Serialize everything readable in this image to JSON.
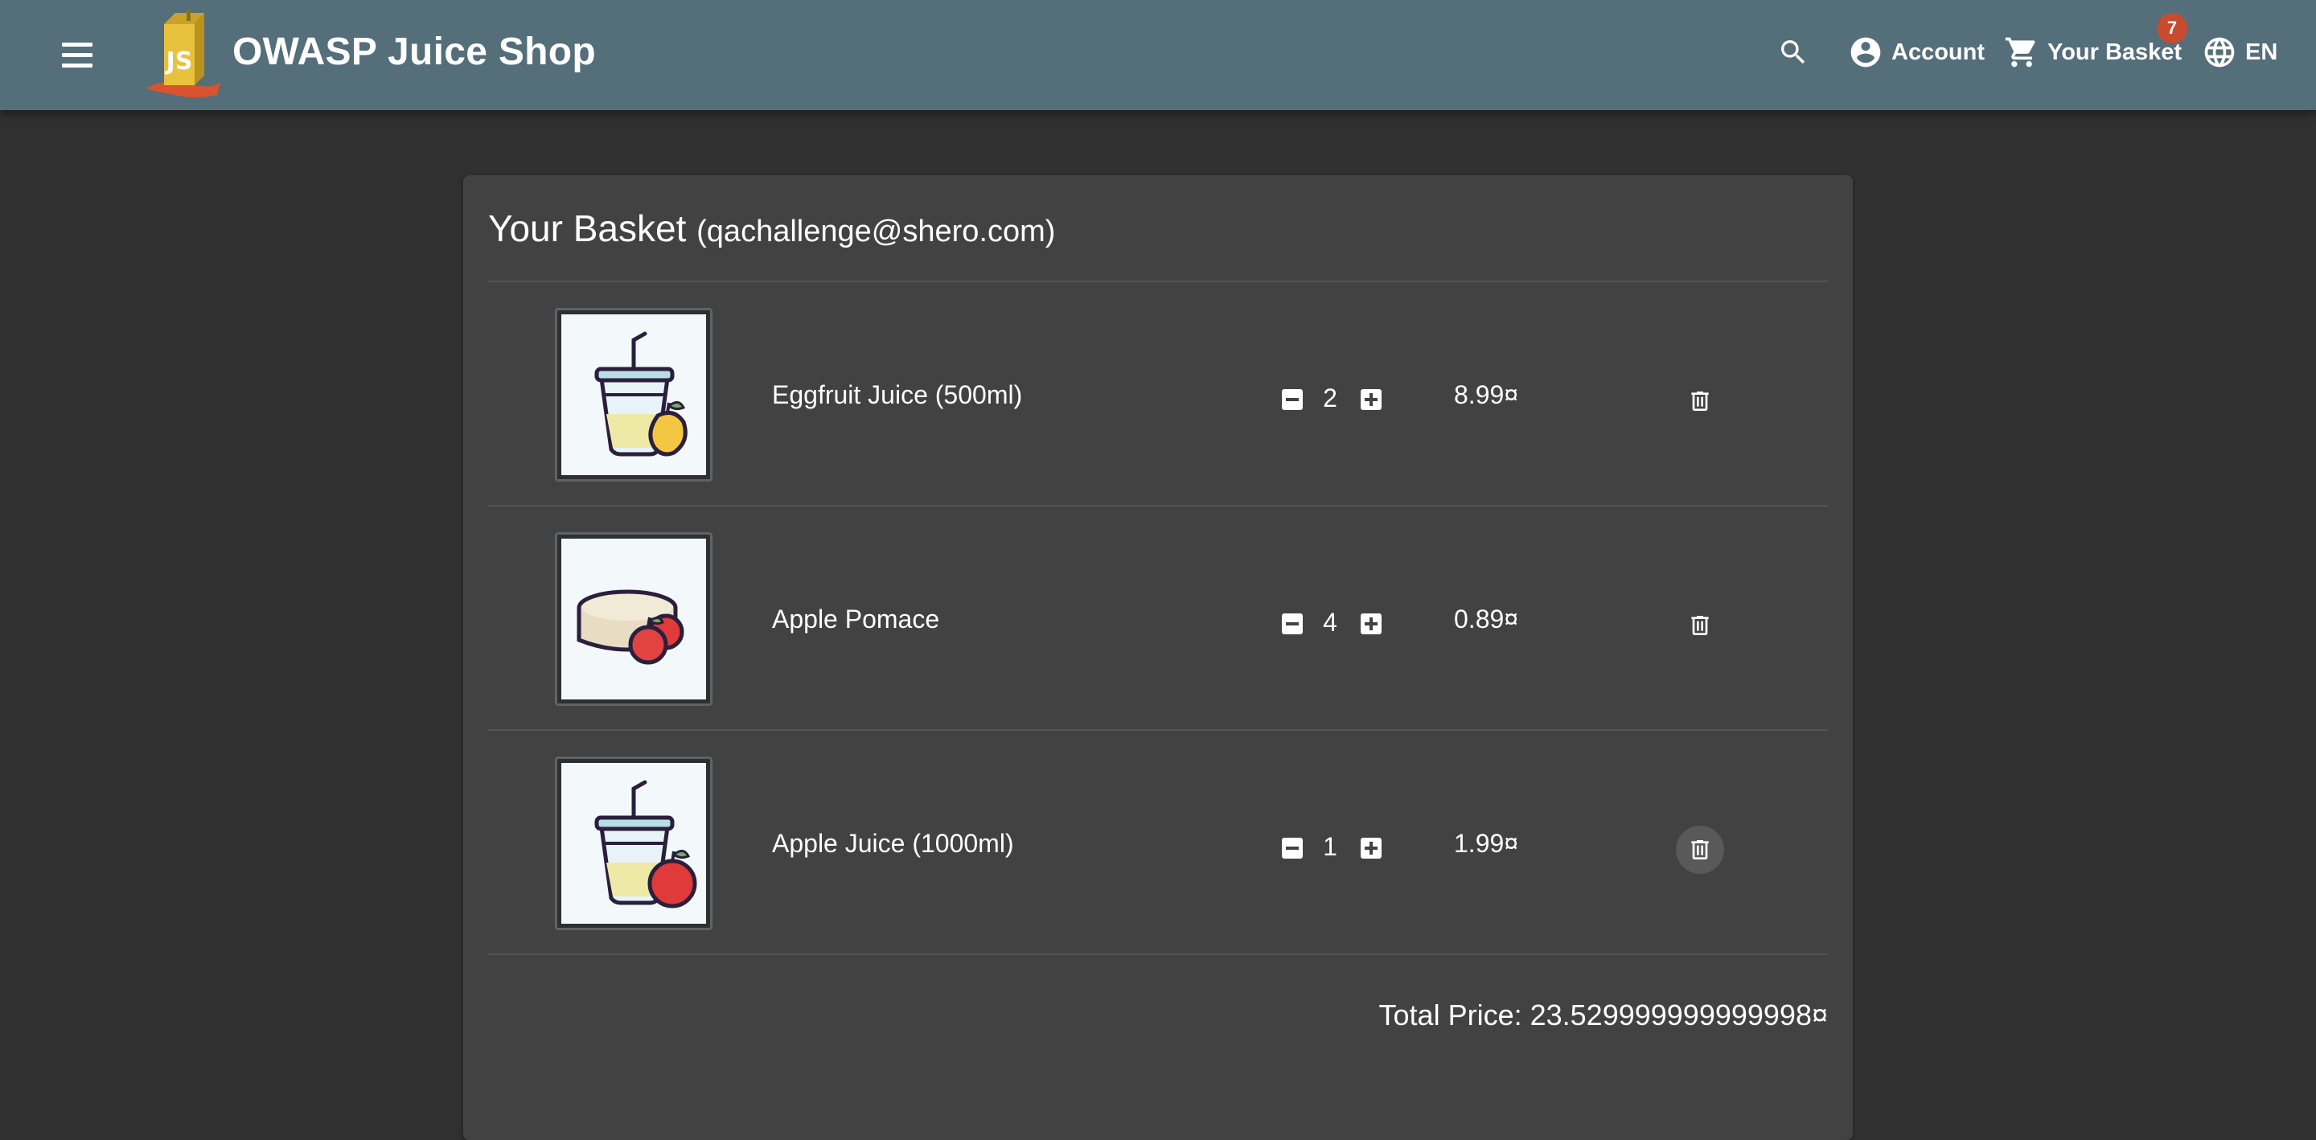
{
  "header": {
    "title": "OWASP Juice Shop",
    "account_label": "Account",
    "basket_label": "Your Basket",
    "basket_count": "7",
    "language_label": "EN"
  },
  "basket": {
    "title": "Your Basket",
    "email": "(qachallenge@shero.com)",
    "items": [
      {
        "name": "Eggfruit Juice (500ml)",
        "quantity": "2",
        "price": "8.99¤"
      },
      {
        "name": "Apple Pomace",
        "quantity": "4",
        "price": "0.89¤"
      },
      {
        "name": "Apple Juice (1000ml)",
        "quantity": "1",
        "price": "1.99¤"
      }
    ],
    "total_price": "Total Price: 23.529999999999998¤"
  },
  "colors": {
    "toolbar": "#546e7a",
    "background": "#303030",
    "card": "#424242",
    "badge": "#c84b2f"
  },
  "icons": {
    "menu": "menu-icon",
    "search": "search-icon",
    "account": "account-circle-icon",
    "basket": "shopping-cart-icon",
    "language": "globe-icon",
    "remove": "minus-box-icon",
    "add": "plus-box-icon",
    "delete": "trash-icon"
  }
}
